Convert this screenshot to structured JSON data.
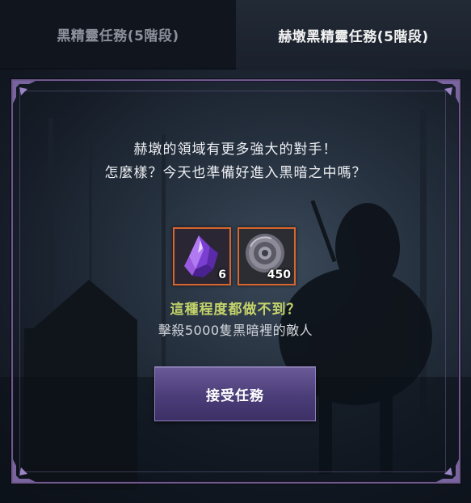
{
  "tabs": [
    {
      "label": "黑精靈任務(5階段)",
      "active": false
    },
    {
      "label": "赫墩黑精靈任務(5階段)",
      "active": true
    }
  ],
  "dialog": {
    "line1": "赫墩的領域有更多強大的對手！",
    "line2": "怎麼樣？今天也準備好進入黑暗之中嗎？"
  },
  "rewards": [
    {
      "icon": "purple-crystal-icon",
      "quantity": "6"
    },
    {
      "icon": "silver-coin-icon",
      "quantity": "450"
    }
  ],
  "quest": {
    "title": "這種程度都做不到？",
    "description": "擊殺5000隻黑暗裡的敵人"
  },
  "accept_button": "接受任務",
  "colors": {
    "frame": "#6f5a8e",
    "reward_border": "#d8662e",
    "quest_title": "#c4d36a",
    "button": "#4b3d78"
  }
}
